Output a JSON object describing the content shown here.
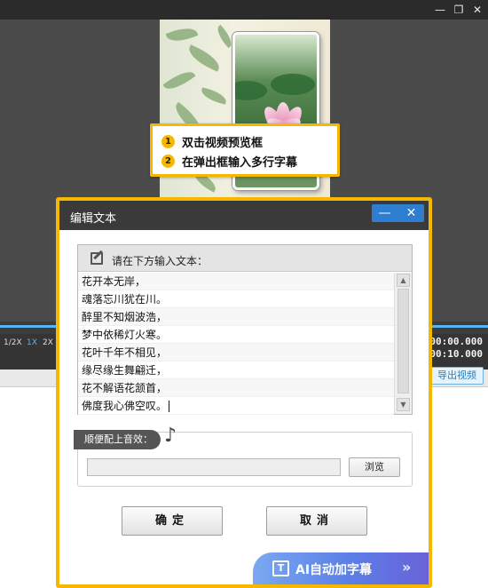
{
  "window": {
    "minimize_glyph": "—",
    "maximize_glyph": "❐",
    "close_glyph": "✕"
  },
  "callout": {
    "steps": [
      {
        "num": "1",
        "text": "双击视频预览框"
      },
      {
        "num": "2",
        "text": "在弹出框输入多行字幕"
      }
    ]
  },
  "player": {
    "speeds": [
      "1/2X",
      "1X",
      "2X"
    ],
    "active_speed": "1X",
    "timecode_current": "00:00.000",
    "timecode_total": "00:10.000",
    "export_label": "导出视频"
  },
  "dialog": {
    "title": "编辑文本",
    "minimize_glyph": "—",
    "close_glyph": "✕",
    "panel_header": "请在下方输入文本：",
    "lines": [
      "花开本无岸，",
      "魂落忘川犹在川。",
      "醉里不知烟波浩，",
      "梦中依稀灯火寒。",
      "花叶千年不相见，",
      "缘尽缘生舞翩迁，",
      "花不解语花颔首，",
      "佛度我心佛空叹。"
    ],
    "audio_tag": "顺便配上音效：",
    "audio_path": "",
    "browse_label": "浏览",
    "ok_label": "确定",
    "cancel_label": "取消",
    "ai_label": "AI自动加字幕",
    "ai_chevron": "»"
  },
  "colors": {
    "accent_yellow": "#f5b800",
    "title_dark": "#3a3a3a",
    "blue_button": "#2d7dd1",
    "ai_gradient_start": "#7aa9f0",
    "ai_gradient_end": "#6a62d8"
  }
}
